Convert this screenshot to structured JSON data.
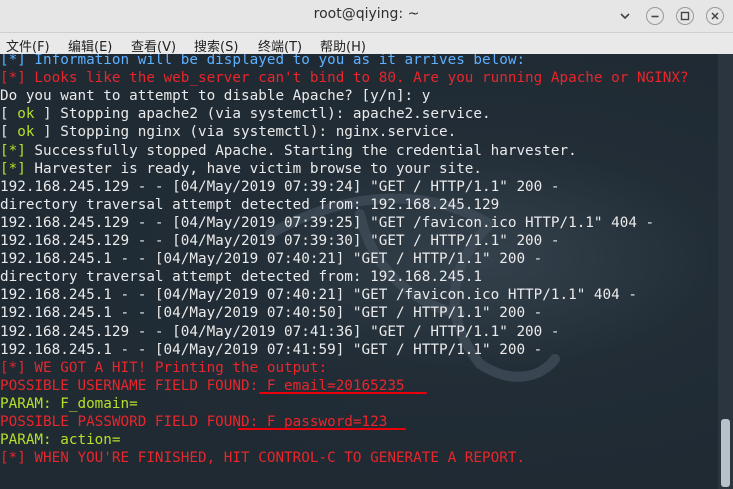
{
  "window": {
    "title": "root@qiying: ~",
    "controls": [
      "chevron-down-icon",
      "minimize-icon",
      "maximize-icon",
      "close-icon"
    ]
  },
  "menubar": {
    "items": [
      "文件(F)",
      "编辑(E)",
      "查看(V)",
      "搜索(S)",
      "终端(T)",
      "帮助(H)"
    ]
  },
  "colors": {
    "terminal_bg": "#1f2a33",
    "text_default": "#eaeaea",
    "text_red": "#e8262b",
    "text_green": "#b6e02a",
    "text_blue": "#5fb0ff",
    "underline_red": "#e8000b"
  },
  "terminal": {
    "lines": [
      {
        "segs": [
          {
            "t": "[*] Information will be displayed to you as it arrives below:",
            "c": "blue"
          }
        ]
      },
      {
        "segs": [
          {
            "t": "[*] Looks like the web_server can't bind to 80. Are you running Apache or NGINX?",
            "c": "red"
          }
        ]
      },
      {
        "segs": [
          {
            "t": "Do you want to attempt to disable Apache? [y/n]: y",
            "c": "white"
          }
        ]
      },
      {
        "segs": [
          {
            "t": "[ ",
            "c": "white"
          },
          {
            "t": "ok",
            "c": "green"
          },
          {
            "t": " ] Stopping apache2 (via systemctl): apache2.service.",
            "c": "white"
          }
        ]
      },
      {
        "segs": [
          {
            "t": "[ ",
            "c": "white"
          },
          {
            "t": "ok",
            "c": "green"
          },
          {
            "t": " ] Stopping nginx (via systemctl): nginx.service.",
            "c": "white"
          }
        ]
      },
      {
        "segs": [
          {
            "t": "[*]",
            "c": "green"
          },
          {
            "t": " Successfully stopped Apache. Starting the credential harvester.",
            "c": "white"
          }
        ]
      },
      {
        "segs": [
          {
            "t": "[*]",
            "c": "green"
          },
          {
            "t": " Harvester is ready, have victim browse to your site.",
            "c": "white"
          }
        ]
      },
      {
        "segs": [
          {
            "t": "192.168.245.129 - - [04/May/2019 07:39:24] \"GET / HTTP/1.1\" 200 -",
            "c": "white"
          }
        ]
      },
      {
        "segs": [
          {
            "t": "directory traversal attempt detected from: 192.168.245.129",
            "c": "white"
          }
        ]
      },
      {
        "segs": [
          {
            "t": "192.168.245.129 - - [04/May/2019 07:39:25] \"GET /favicon.ico HTTP/1.1\" 404 -",
            "c": "white"
          }
        ]
      },
      {
        "segs": [
          {
            "t": "192.168.245.129 - - [04/May/2019 07:39:30] \"GET / HTTP/1.1\" 200 -",
            "c": "white"
          }
        ]
      },
      {
        "segs": [
          {
            "t": "192.168.245.1 - - [04/May/2019 07:40:21] \"GET / HTTP/1.1\" 200 -",
            "c": "white"
          }
        ]
      },
      {
        "segs": [
          {
            "t": "directory traversal attempt detected from: 192.168.245.1",
            "c": "white"
          }
        ]
      },
      {
        "segs": [
          {
            "t": "192.168.245.1 - - [04/May/2019 07:40:21] \"GET /favicon.ico HTTP/1.1\" 404 -",
            "c": "white"
          }
        ]
      },
      {
        "segs": [
          {
            "t": "192.168.245.1 - - [04/May/2019 07:40:50] \"GET / HTTP/1.1\" 200 -",
            "c": "white"
          }
        ]
      },
      {
        "segs": [
          {
            "t": "192.168.245.129 - - [04/May/2019 07:41:36] \"GET / HTTP/1.1\" 200 -",
            "c": "white"
          }
        ]
      },
      {
        "segs": [
          {
            "t": "192.168.245.1 - - [04/May/2019 07:41:59] \"GET / HTTP/1.1\" 200 -",
            "c": "white"
          }
        ]
      },
      {
        "segs": [
          {
            "t": "[*] WE GOT A HIT! Printing the output:",
            "c": "red"
          }
        ]
      },
      {
        "segs": [
          {
            "t": "POSSIBLE USERNAME FIELD FOUND: F_email=20165235",
            "c": "red"
          }
        ]
      },
      {
        "segs": [
          {
            "t": "PARAM: F_domain=",
            "c": "green"
          }
        ]
      },
      {
        "segs": [
          {
            "t": "POSSIBLE PASSWORD FIELD FOUND: F_password=123",
            "c": "red"
          }
        ]
      },
      {
        "segs": [
          {
            "t": "PARAM: action=",
            "c": "green"
          }
        ]
      },
      {
        "segs": [
          {
            "t": "[*] WHEN YOU'RE FINISHED, HIT CONTROL-C TO GENERATE A REPORT.",
            "c": "red"
          }
        ]
      }
    ]
  }
}
